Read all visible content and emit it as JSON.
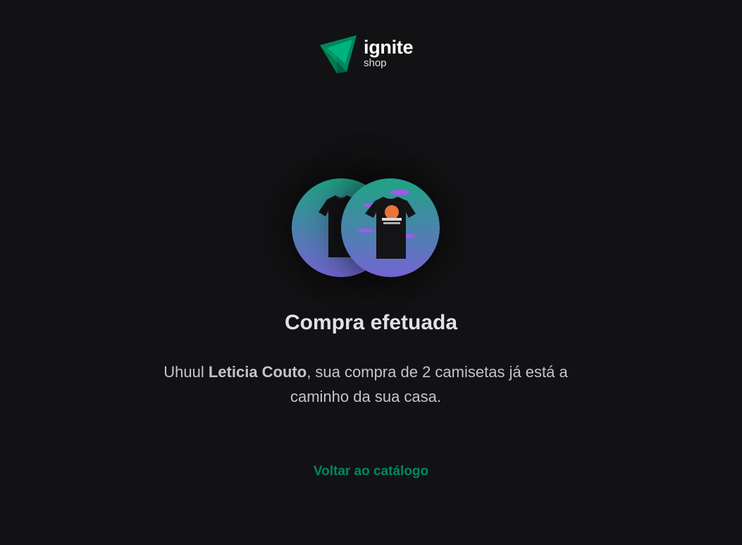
{
  "header": {
    "logo_title": "ignite",
    "logo_subtitle": "shop"
  },
  "products": [
    {
      "image": "t-shirt-icon",
      "name": ""
    },
    {
      "image": "t-shirt-icon",
      "name": ""
    }
  ],
  "success": {
    "title": "Compra efetuada",
    "message_prefix": "Uhuul ",
    "customer_name": "Leticia Couto",
    "message_middle": ", sua compra de 2 camisetas já está a caminho da sua casa.",
    "back_link": "Voltar ao catálogo"
  },
  "colors": {
    "background": "#121214",
    "accent": "#00875f",
    "gradient_start": "#1ea483",
    "gradient_end": "#7465d4"
  }
}
